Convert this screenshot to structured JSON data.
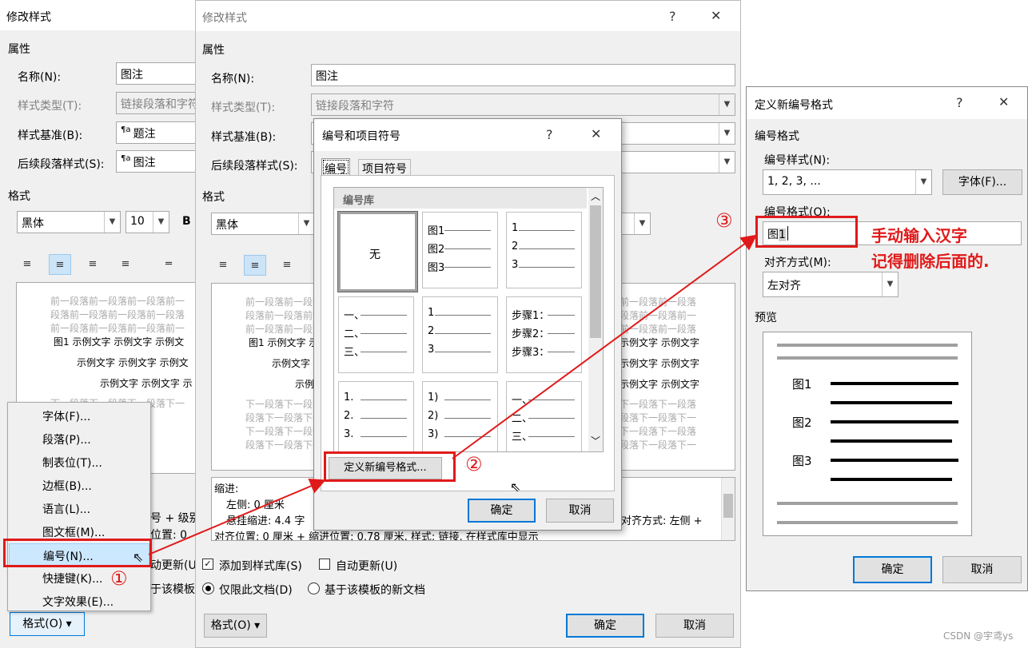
{
  "dialog1": {
    "title": "修改样式",
    "section_props": "属性",
    "name_label": "名称(N):",
    "name_value": "图注",
    "type_label": "样式类型(T):",
    "type_value": "链接段落和字符",
    "base_label": "样式基准(B):",
    "base_value": "题注",
    "next_label": "后续段落样式(S):",
    "next_value": "图注",
    "section_format": "格式",
    "font_value": "黑体",
    "size_value": "10",
    "bold_label": "B",
    "preview_prev": [
      "前一段落前一段落前一段落前一",
      "段落前一段落前一段落前一段落",
      "前一段落前一段落前一段落前一"
    ],
    "preview_sample": [
      "图1  示例文字  示例文字  示例文",
      "示例文字  示例文字  示例文",
      "示例文字  示例文字  示"
    ],
    "preview_next": [
      "下一段落下一段落下一段落下一",
      "段落下一段落下一段落下一段落",
      "下一段落下一段落下一段落下一",
      "段落下一段落下一段落"
    ],
    "desc_fragments": [
      "号 + 级别",
      "位置: 0."
    ],
    "auto_update_frag": "动更新(U",
    "template_frag": "于该模板的",
    "format_button": "格式(O) ▾"
  },
  "context_menu": {
    "items": [
      "字体(F)...",
      "段落(P)...",
      "制表位(T)...",
      "边框(B)...",
      "语言(L)...",
      "图文框(M)...",
      "编号(N)...",
      "快捷键(K)...",
      "文字效果(E)..."
    ]
  },
  "dialog2": {
    "title": "修改样式",
    "help": "?",
    "close": "✕",
    "section_props": "属性",
    "name_label": "名称(N):",
    "name_value": "图注",
    "type_label": "样式类型(T):",
    "type_value": "链接段落和字符",
    "base_label": "样式基准(B):",
    "next_label": "后续段落样式(S):",
    "section_format": "格式",
    "font_value": "黑体",
    "preview_prev": [
      "前一段落前一段落前一段落前一",
      "段落前一段落前一段落前一段落",
      "前一段落前一段落前一段落前一"
    ],
    "preview_sample": [
      "图1  示例文字  示例文字",
      "示例文字  示例文字",
      "示例"
    ],
    "preview_next": [
      "下一段落下一段落下一段落下一",
      "段落下一段落下一段落下一段落",
      "下一段落下一段落下一段落下一",
      "段落下一段落下一段落"
    ],
    "preview_right_prev": [
      "前一段落前一段落",
      "段落前一段落前一",
      "前一段落前一段落"
    ],
    "preview_right_sample": [
      "示例文字  示例文字",
      "示例文字  示例文字",
      "示例文字  示例文字"
    ],
    "preview_right_next": [
      "下一段落下一段落",
      "段落下一段落下一",
      "下一段落下一段落",
      "段落下一段落下一"
    ],
    "indent_title": "缩进:",
    "indent_left": "左侧: 0 厘米",
    "indent_hang": "悬挂缩进: 4.4 字",
    "indent_align": "对齐方式: 左侧 +",
    "indent_pos": "对齐位置: 0 厘米 + 缩进位置: 0.78 厘米, 样式: 链接, 在样式库中显示",
    "add_gallery": "添加到样式库(S)",
    "auto_update": "自动更新(U)",
    "only_doc": "仅限此文档(D)",
    "template_doc": "基于该模板的新文档",
    "format_button": "格式(O) ▾",
    "ok": "确定",
    "cancel": "取消"
  },
  "dialog3": {
    "title": "编号和项目符号",
    "help": "?",
    "close": "✕",
    "tab_numbering": "编号",
    "tab_bullets": "项目符号",
    "library_label": "编号库",
    "none_label": "无",
    "cells": [
      [
        "图1",
        "图2",
        "图3"
      ],
      [
        "1",
        "2",
        "3"
      ],
      [
        "一、",
        "二、",
        "三、"
      ],
      [
        "1",
        "2",
        "3"
      ],
      [
        "步骤1：",
        "步骤2：",
        "步骤3："
      ],
      [
        "1.",
        "2.",
        "3."
      ],
      [
        "1)",
        "2)",
        "3)"
      ],
      [
        "一、",
        "二、",
        "三、"
      ]
    ],
    "define_button": "定义新编号格式...",
    "ok": "确定",
    "cancel": "取消"
  },
  "dialog4": {
    "title": "定义新编号格式",
    "help": "?",
    "close": "✕",
    "section_format": "编号格式",
    "style_label": "编号样式(N):",
    "style_value": "1, 2, 3, ...",
    "font_button": "字体(F)...",
    "format_label": "编号格式(O):",
    "format_prefix": "图",
    "format_num": "1",
    "align_label": "对齐方式(M):",
    "align_value": "左对齐",
    "preview_label": "预览",
    "preview_items": [
      "图1",
      "图2",
      "图3"
    ],
    "ok": "确定",
    "cancel": "取消"
  },
  "annotations": {
    "step1": "①",
    "step2": "②",
    "step3": "③",
    "note_line1": "手动输入汉字",
    "note_line2": "记得删除后面的.",
    "accent_color": "#e01a1a"
  },
  "watermark": "CSDN @宇鸢ys"
}
